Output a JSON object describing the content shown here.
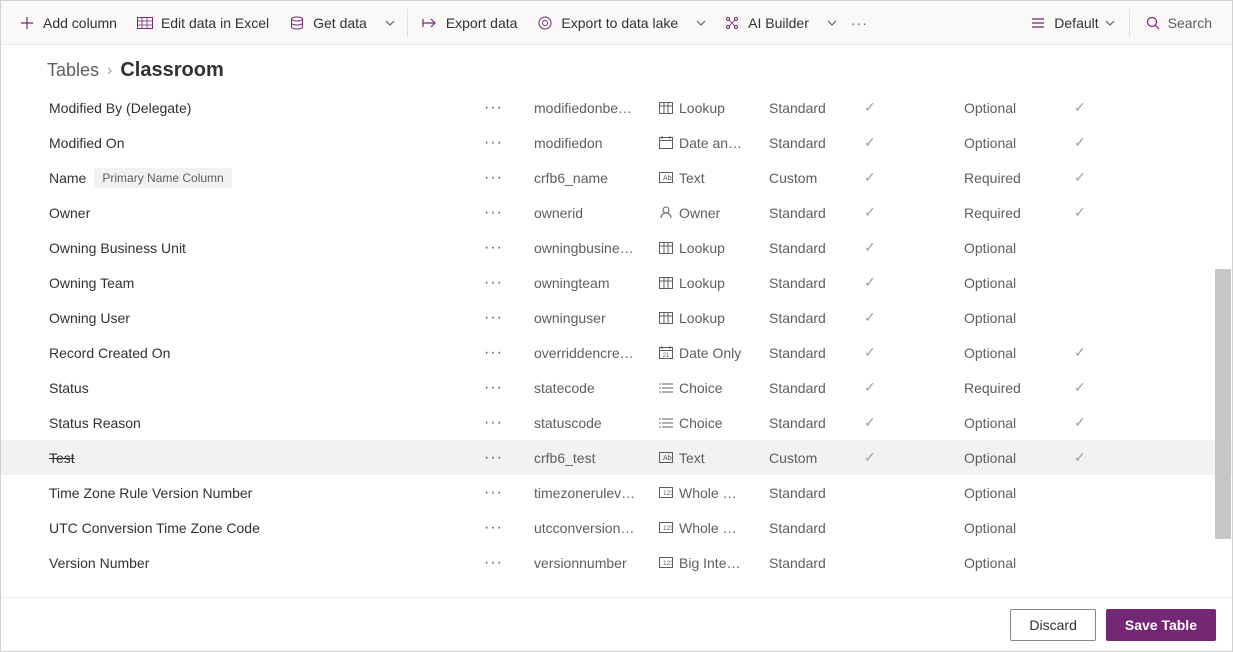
{
  "toolbar": {
    "add_column": "Add column",
    "edit_data": "Edit data in Excel",
    "get_data": "Get data",
    "export_data": "Export data",
    "export_lake": "Export to data lake",
    "ai_builder": "AI Builder",
    "view_label": "Default",
    "search_placeholder": "Search"
  },
  "breadcrumb": {
    "parent": "Tables",
    "current": "Classroom"
  },
  "badge_primary_name": "Primary Name Column",
  "rows": [
    {
      "display": "Modified By (Delegate)",
      "name": "modifiedonbe…",
      "type_icon": "lookup",
      "type": "Lookup",
      "category": "Standard",
      "managed": true,
      "required": "Optional",
      "customizable": true,
      "strike": false,
      "badge": false,
      "highlight": false
    },
    {
      "display": "Modified On",
      "name": "modifiedon",
      "type_icon": "datetime",
      "type": "Date an…",
      "category": "Standard",
      "managed": true,
      "required": "Optional",
      "customizable": true,
      "strike": false,
      "badge": false,
      "highlight": false
    },
    {
      "display": "Name",
      "name": "crfb6_name",
      "type_icon": "text",
      "type": "Text",
      "category": "Custom",
      "managed": true,
      "required": "Required",
      "customizable": true,
      "strike": false,
      "badge": true,
      "highlight": false
    },
    {
      "display": "Owner",
      "name": "ownerid",
      "type_icon": "owner",
      "type": "Owner",
      "category": "Standard",
      "managed": true,
      "required": "Required",
      "customizable": true,
      "strike": false,
      "badge": false,
      "highlight": false
    },
    {
      "display": "Owning Business Unit",
      "name": "owningbusine…",
      "type_icon": "lookup",
      "type": "Lookup",
      "category": "Standard",
      "managed": true,
      "required": "Optional",
      "customizable": false,
      "strike": false,
      "badge": false,
      "highlight": false
    },
    {
      "display": "Owning Team",
      "name": "owningteam",
      "type_icon": "lookup",
      "type": "Lookup",
      "category": "Standard",
      "managed": true,
      "required": "Optional",
      "customizable": false,
      "strike": false,
      "badge": false,
      "highlight": false
    },
    {
      "display": "Owning User",
      "name": "owninguser",
      "type_icon": "lookup",
      "type": "Lookup",
      "category": "Standard",
      "managed": true,
      "required": "Optional",
      "customizable": false,
      "strike": false,
      "badge": false,
      "highlight": false
    },
    {
      "display": "Record Created On",
      "name": "overriddencre…",
      "type_icon": "dateonly",
      "type": "Date Only",
      "category": "Standard",
      "managed": true,
      "required": "Optional",
      "customizable": true,
      "strike": false,
      "badge": false,
      "highlight": false
    },
    {
      "display": "Status",
      "name": "statecode",
      "type_icon": "choice",
      "type": "Choice",
      "category": "Standard",
      "managed": true,
      "required": "Required",
      "customizable": true,
      "strike": false,
      "badge": false,
      "highlight": false
    },
    {
      "display": "Status Reason",
      "name": "statuscode",
      "type_icon": "choice",
      "type": "Choice",
      "category": "Standard",
      "managed": true,
      "required": "Optional",
      "customizable": true,
      "strike": false,
      "badge": false,
      "highlight": false
    },
    {
      "display": "Test",
      "name": "crfb6_test",
      "type_icon": "text",
      "type": "Text",
      "category": "Custom",
      "managed": true,
      "required": "Optional",
      "customizable": true,
      "strike": true,
      "badge": false,
      "highlight": true
    },
    {
      "display": "Time Zone Rule Version Number",
      "name": "timezonerulev…",
      "type_icon": "whole",
      "type": "Whole …",
      "category": "Standard",
      "managed": false,
      "required": "Optional",
      "customizable": false,
      "strike": false,
      "badge": false,
      "highlight": false
    },
    {
      "display": "UTC Conversion Time Zone Code",
      "name": "utcconversion…",
      "type_icon": "whole",
      "type": "Whole …",
      "category": "Standard",
      "managed": false,
      "required": "Optional",
      "customizable": false,
      "strike": false,
      "badge": false,
      "highlight": false
    },
    {
      "display": "Version Number",
      "name": "versionnumber",
      "type_icon": "bigint",
      "type": "Big Inte…",
      "category": "Standard",
      "managed": false,
      "required": "Optional",
      "customizable": false,
      "strike": false,
      "badge": false,
      "highlight": false
    }
  ],
  "footer": {
    "discard": "Discard",
    "save": "Save Table"
  }
}
